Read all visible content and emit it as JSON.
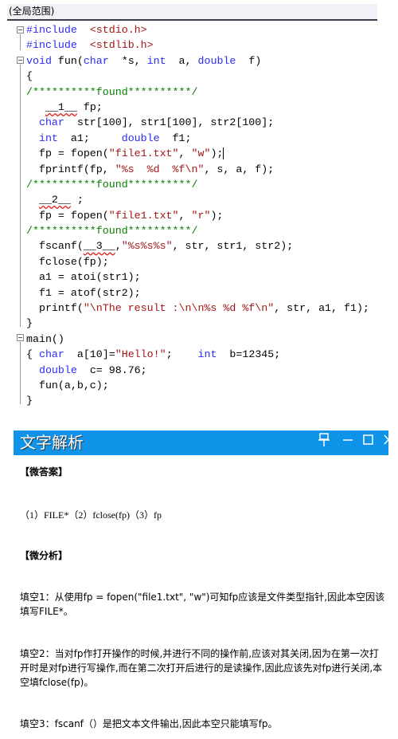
{
  "scope_label": "(全局范围)",
  "code": {
    "lines": [
      [
        {
          "c": "pp",
          "s": "#include"
        },
        {
          "c": "",
          "s": "  "
        },
        {
          "c": "inc",
          "s": "<stdio.h>"
        }
      ],
      [
        {
          "c": "pp",
          "s": "#include"
        },
        {
          "c": "",
          "s": "  "
        },
        {
          "c": "inc",
          "s": "<stdlib.h>"
        }
      ],
      [
        {
          "c": "kw",
          "s": "void"
        },
        {
          "c": "",
          "s": " fun("
        },
        {
          "c": "kw",
          "s": "char"
        },
        {
          "c": "",
          "s": "  *s, "
        },
        {
          "c": "kw",
          "s": "int"
        },
        {
          "c": "",
          "s": "  a, "
        },
        {
          "c": "kw",
          "s": "double"
        },
        {
          "c": "",
          "s": "  f)"
        }
      ],
      [
        {
          "c": "",
          "s": "{"
        }
      ],
      [
        {
          "c": "cm",
          "s": "/**********found**********/"
        }
      ],
      [
        {
          "c": "",
          "s": "   "
        },
        {
          "c": "blank",
          "s": "__1__"
        },
        {
          "c": "",
          "s": " fp;"
        }
      ],
      [
        {
          "c": "",
          "s": "  "
        },
        {
          "c": "kw",
          "s": "char"
        },
        {
          "c": "",
          "s": "  str[100], str1[100], str2[100];"
        }
      ],
      [
        {
          "c": "",
          "s": "  "
        },
        {
          "c": "kw",
          "s": "int"
        },
        {
          "c": "",
          "s": "  a1;     "
        },
        {
          "c": "kw",
          "s": "double"
        },
        {
          "c": "",
          "s": "  f1;"
        }
      ],
      [
        {
          "c": "",
          "s": "  fp = fopen("
        },
        {
          "c": "str",
          "s": "\"file1.txt\""
        },
        {
          "c": "",
          "s": ", "
        },
        {
          "c": "str",
          "s": "\"w\""
        },
        {
          "c": "",
          "s": ");"
        },
        {
          "c": "caret",
          "s": ""
        }
      ],
      [
        {
          "c": "",
          "s": "  fprintf(fp, "
        },
        {
          "c": "str",
          "s": "\"%s  %d  %f\\n\""
        },
        {
          "c": "",
          "s": ", s, a, f);"
        }
      ],
      [
        {
          "c": "cm",
          "s": "/**********found**********/"
        }
      ],
      [
        {
          "c": "",
          "s": "  "
        },
        {
          "c": "blank",
          "s": "__2__"
        },
        {
          "c": "",
          "s": " ;"
        }
      ],
      [
        {
          "c": "",
          "s": "  fp = fopen("
        },
        {
          "c": "str",
          "s": "\"file1.txt\""
        },
        {
          "c": "",
          "s": ", "
        },
        {
          "c": "str",
          "s": "\"r\""
        },
        {
          "c": "",
          "s": ");"
        }
      ],
      [
        {
          "c": "cm",
          "s": "/**********found**********/"
        }
      ],
      [
        {
          "c": "",
          "s": "  fscanf("
        },
        {
          "c": "blank",
          "s": "__3__"
        },
        {
          "c": "",
          "s": ","
        },
        {
          "c": "str",
          "s": "\"%s%s%s\""
        },
        {
          "c": "",
          "s": ", str, str1, str2);"
        }
      ],
      [
        {
          "c": "",
          "s": "  fclose(fp);"
        }
      ],
      [
        {
          "c": "",
          "s": "  a1 = atoi(str1);"
        }
      ],
      [
        {
          "c": "",
          "s": "  f1 = atof(str2);"
        }
      ],
      [
        {
          "c": "",
          "s": "  printf("
        },
        {
          "c": "str",
          "s": "\"\\nThe result :\\n\\n%s %d %f\\n\""
        },
        {
          "c": "",
          "s": ", str, a1, f1);"
        }
      ],
      [
        {
          "c": "",
          "s": "}"
        }
      ],
      [
        {
          "c": "",
          "s": "main()"
        }
      ],
      [
        {
          "c": "",
          "s": "{ "
        },
        {
          "c": "kw",
          "s": "char"
        },
        {
          "c": "",
          "s": "  a[10]="
        },
        {
          "c": "str",
          "s": "\"Hello!\""
        },
        {
          "c": "",
          "s": ";    "
        },
        {
          "c": "kw",
          "s": "int"
        },
        {
          "c": "",
          "s": "  b=12345;"
        }
      ],
      [
        {
          "c": "",
          "s": "  "
        },
        {
          "c": "kw",
          "s": "double"
        },
        {
          "c": "",
          "s": "  c= 98.76;"
        }
      ],
      [
        {
          "c": "",
          "s": "  fun(a,b,c);"
        }
      ],
      [
        {
          "c": "",
          "s": "}"
        }
      ]
    ]
  },
  "panel": {
    "title": "文字解析",
    "color": "#0f93e8",
    "icons": [
      "pin-icon",
      "minimize-icon",
      "maximize-icon",
      "close-icon"
    ]
  },
  "analysis": {
    "answer_heading": "【微答案】",
    "answer": "（1）FILE*（2）fclose(fp)（3）fp",
    "analysis_heading": "【微分析】",
    "paragraphs": [
      "填空1：从使用fp = fopen(\"file1.txt\", \"w\")可知fp应该是文件类型指针,因此本空因该填写FILE*。",
      "填空2：当对fp作打开操作的时候,并进行不同的操作前,应该对其关闭,因为在第一次打开时是对fp进行写操作,而在第二次打开后进行的是读操作,因此应该先对fp进行关闭,本空填fclose(fp)。",
      "填空3：fscanf（）是把文本文件输出,因此本空只能填写fp。"
    ]
  }
}
